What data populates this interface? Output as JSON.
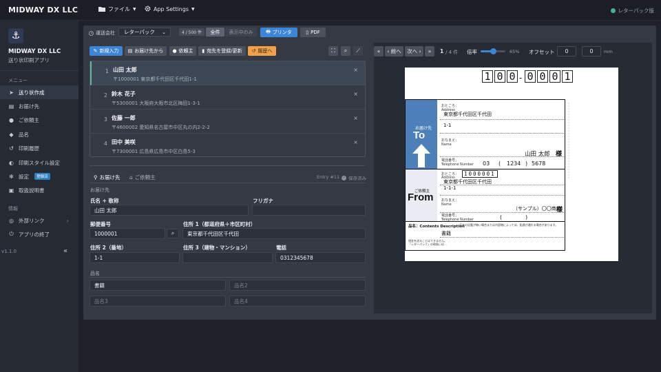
{
  "app": {
    "company": "MIDWAY DX LLC",
    "menu_file": "ファイル",
    "menu_settings": "App Settings",
    "status": "レターパック版"
  },
  "sidebar": {
    "company": "MIDWAY DX LLC",
    "app_name": "送り状印刷アプリ",
    "section_menu": "メニュー",
    "section_info": "情報",
    "items": [
      {
        "label": "送り状作成",
        "icon": "send-icon"
      },
      {
        "label": "お届け先",
        "icon": "address-card-icon"
      },
      {
        "label": "ご依頼主",
        "icon": "user-icon"
      },
      {
        "label": "品名",
        "icon": "tag-icon"
      },
      {
        "label": "印刷履歴",
        "icon": "history-icon"
      },
      {
        "label": "印刷スタイル設定",
        "icon": "palette-icon"
      },
      {
        "label": "設定",
        "icon": "gear-icon",
        "badge": "登録済"
      },
      {
        "label": "取扱説明書",
        "icon": "book-icon"
      }
    ],
    "info_items": [
      {
        "label": "外部リンク",
        "icon": "globe-icon"
      },
      {
        "label": "アプリの終了",
        "icon": "power-icon"
      }
    ],
    "version": "v1.1.0",
    "collapse": "«"
  },
  "toolbar": {
    "carrier_label": "運送会社",
    "carrier_value": "レターパック",
    "count": "4 / 500 件",
    "all": "全件",
    "showing": "表示中のみ",
    "printer": "プリンタ",
    "pdf": "PDF",
    "new": "新規入力",
    "from_dest": "お届け先から",
    "from_client": "依頼主",
    "register": "宛先を登録/更新",
    "history": "履歴へ"
  },
  "list": [
    {
      "num": "1",
      "name": "山田 太郎",
      "addr": "〒1000001  東京都千代田区千代田1-1"
    },
    {
      "num": "2",
      "name": "鈴木 花子",
      "addr": "〒5300001  大阪府大阪市北区梅田1-3-1"
    },
    {
      "num": "3",
      "name": "佐藤 一郎",
      "addr": "〒4600002  愛知県名古屋市中区丸の内2-2-2"
    },
    {
      "num": "4",
      "name": "田中 美咲",
      "addr": "〒7300001  広島県広島市中区白島5-3"
    }
  ],
  "form": {
    "tab_dest": "お届け先",
    "tab_client": "ご依頼主",
    "entry": "Entry #11",
    "saved": "保存済み",
    "section_dest": "お届け先",
    "name_label": "氏名 + 敬称",
    "name_value": "山田 太郎",
    "kana_label": "フリガナ",
    "kana_value": "",
    "zip_label": "郵便番号",
    "zip_value": "1000001",
    "addr1_label": "住所 1（都道府県＋市区町村）",
    "addr1_value": "東京都千代田区千代田",
    "addr2_label": "住所 2（番地）",
    "addr2_value": "1-1",
    "addr3_label": "住所 3（建物・マンション）",
    "addr3_value": "",
    "tel_label": "電話",
    "tel_value": "0312345678",
    "section_items": "品名",
    "item1": "書籍",
    "item2_ph": "品名2",
    "item3_ph": "品名3",
    "item4_ph": "品名4"
  },
  "preview": {
    "first": "«",
    "prev": "‹ 前へ",
    "next": "次へ ›",
    "last": "»",
    "page": "1",
    "page_total": "/ 4 件",
    "zoom_label": "倍率",
    "zoom_value": "65%",
    "zoom_fraction": 0.65,
    "offset_label": "オフセット",
    "offset_x": "0",
    "offset_y": "0",
    "unit": "mm"
  },
  "label": {
    "zip_digits": [
      "1",
      "0",
      "0",
      "0",
      "0",
      "0",
      "1"
    ],
    "to_addr_small": "おところ：\nAddress",
    "to_addr1": "東京都千代田区千代田",
    "to_addr2": "1-1",
    "to_name_small": "おなまえ：\nName",
    "to_name": "山田 太郎",
    "sama": "様",
    "tel_small": "電話番号：\nTelephone Number",
    "tel_a": "03",
    "tel_b": "1234",
    "tel_c": "5678",
    "to_band": "お届け先",
    "to_big": "To",
    "from_band": "ご依頼主",
    "from_big": "From",
    "from_zip": "1000001",
    "from_addr1": "東京都千代田区千代田",
    "from_addr2": "1-1-1",
    "from_name": "（サンプル）〇〇商店",
    "contents_label": "品名：Contents Description",
    "contents_note": "品名の記載が無い場合または内容物によっては、配達が遅れる場合があります。",
    "contents_value": "書籍",
    "cash_note": "現金を送ることはできません。\n「レターパック」の取扱いは…"
  }
}
